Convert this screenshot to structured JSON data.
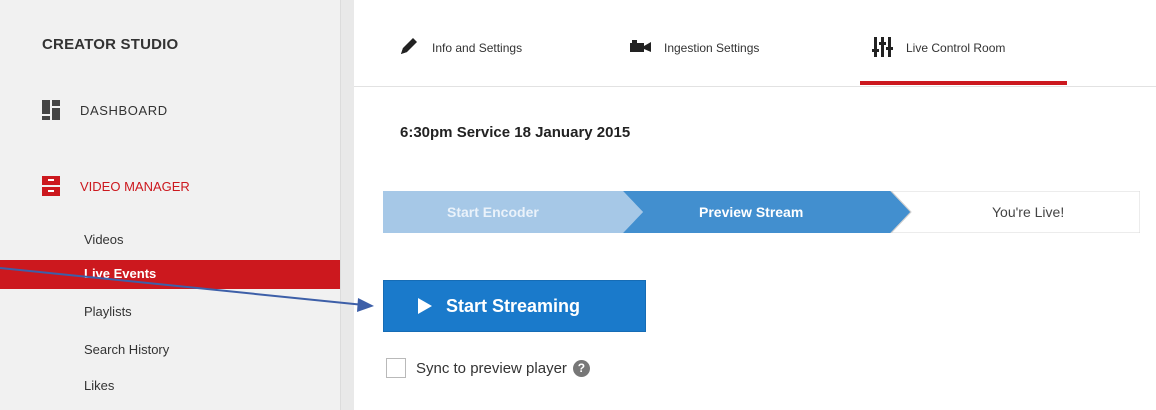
{
  "sidebar": {
    "title": "CREATOR STUDIO",
    "dashboard": "DASHBOARD",
    "video_manager": "VIDEO MANAGER",
    "sub_items": [
      "Videos",
      "Live Events",
      "Playlists",
      "Search History",
      "Likes"
    ],
    "active_item": "Live Events"
  },
  "tabs": {
    "info": "Info and Settings",
    "ingestion": "Ingestion Settings",
    "control_room": "Live Control Room",
    "active": "Live Control Room"
  },
  "event": {
    "title": "6:30pm Service 18 January 2015"
  },
  "steps": [
    "Start Encoder",
    "Preview Stream",
    "You're Live!"
  ],
  "stream_button": {
    "label": "Start Streaming"
  },
  "sync": {
    "label": "Sync to preview player",
    "checked": false
  },
  "colors": {
    "accent_red": "#cc181e",
    "button_blue": "#1a7acb",
    "step_done": "#a6c8e7",
    "step_current": "#428fcf",
    "annotation_arrow": "#3d5fa8"
  }
}
